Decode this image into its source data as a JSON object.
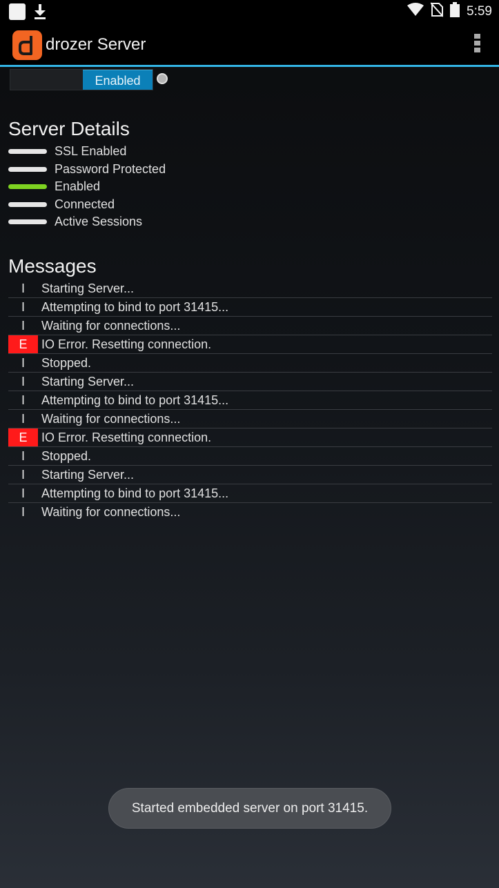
{
  "status_bar": {
    "time": "5:59",
    "icons": [
      "notification-square-icon",
      "download-icon",
      "wifi-icon",
      "no-sim-icon",
      "battery-icon"
    ]
  },
  "app_bar": {
    "logo_letter": "d",
    "title": "drozer Server",
    "menu_icon": "overflow-menu-icon"
  },
  "toggle": {
    "label": "Enabled",
    "state": "on"
  },
  "server_details": {
    "heading": "Server Details",
    "items": [
      {
        "label": "SSL Enabled",
        "active": false
      },
      {
        "label": "Password Protected",
        "active": false
      },
      {
        "label": "Enabled",
        "active": true
      },
      {
        "label": "Connected",
        "active": false
      },
      {
        "label": "Active Sessions",
        "active": false
      }
    ]
  },
  "messages": {
    "heading": "Messages",
    "items": [
      {
        "level": "I",
        "text": "Starting Server..."
      },
      {
        "level": "I",
        "text": "Attempting to bind to port 31415..."
      },
      {
        "level": "I",
        "text": "Waiting for connections..."
      },
      {
        "level": "E",
        "text": "IO Error. Resetting connection."
      },
      {
        "level": "I",
        "text": "Stopped."
      },
      {
        "level": "I",
        "text": "Starting Server..."
      },
      {
        "level": "I",
        "text": "Attempting to bind to port 31415..."
      },
      {
        "level": "I",
        "text": "Waiting for connections..."
      },
      {
        "level": "E",
        "text": "IO Error. Resetting connection."
      },
      {
        "level": "I",
        "text": "Stopped."
      },
      {
        "level": "I",
        "text": "Starting Server..."
      },
      {
        "level": "I",
        "text": "Attempting to bind to port 31415..."
      },
      {
        "level": "I",
        "text": "Waiting for connections..."
      }
    ]
  },
  "toast": {
    "text": "Started embedded server on port 31415."
  },
  "colors": {
    "accent": "#33b5e5",
    "toggle_on": "#0b80b8",
    "logo": "#f26522",
    "indicator_on": "#7ed321",
    "error": "#ff1a1a"
  }
}
